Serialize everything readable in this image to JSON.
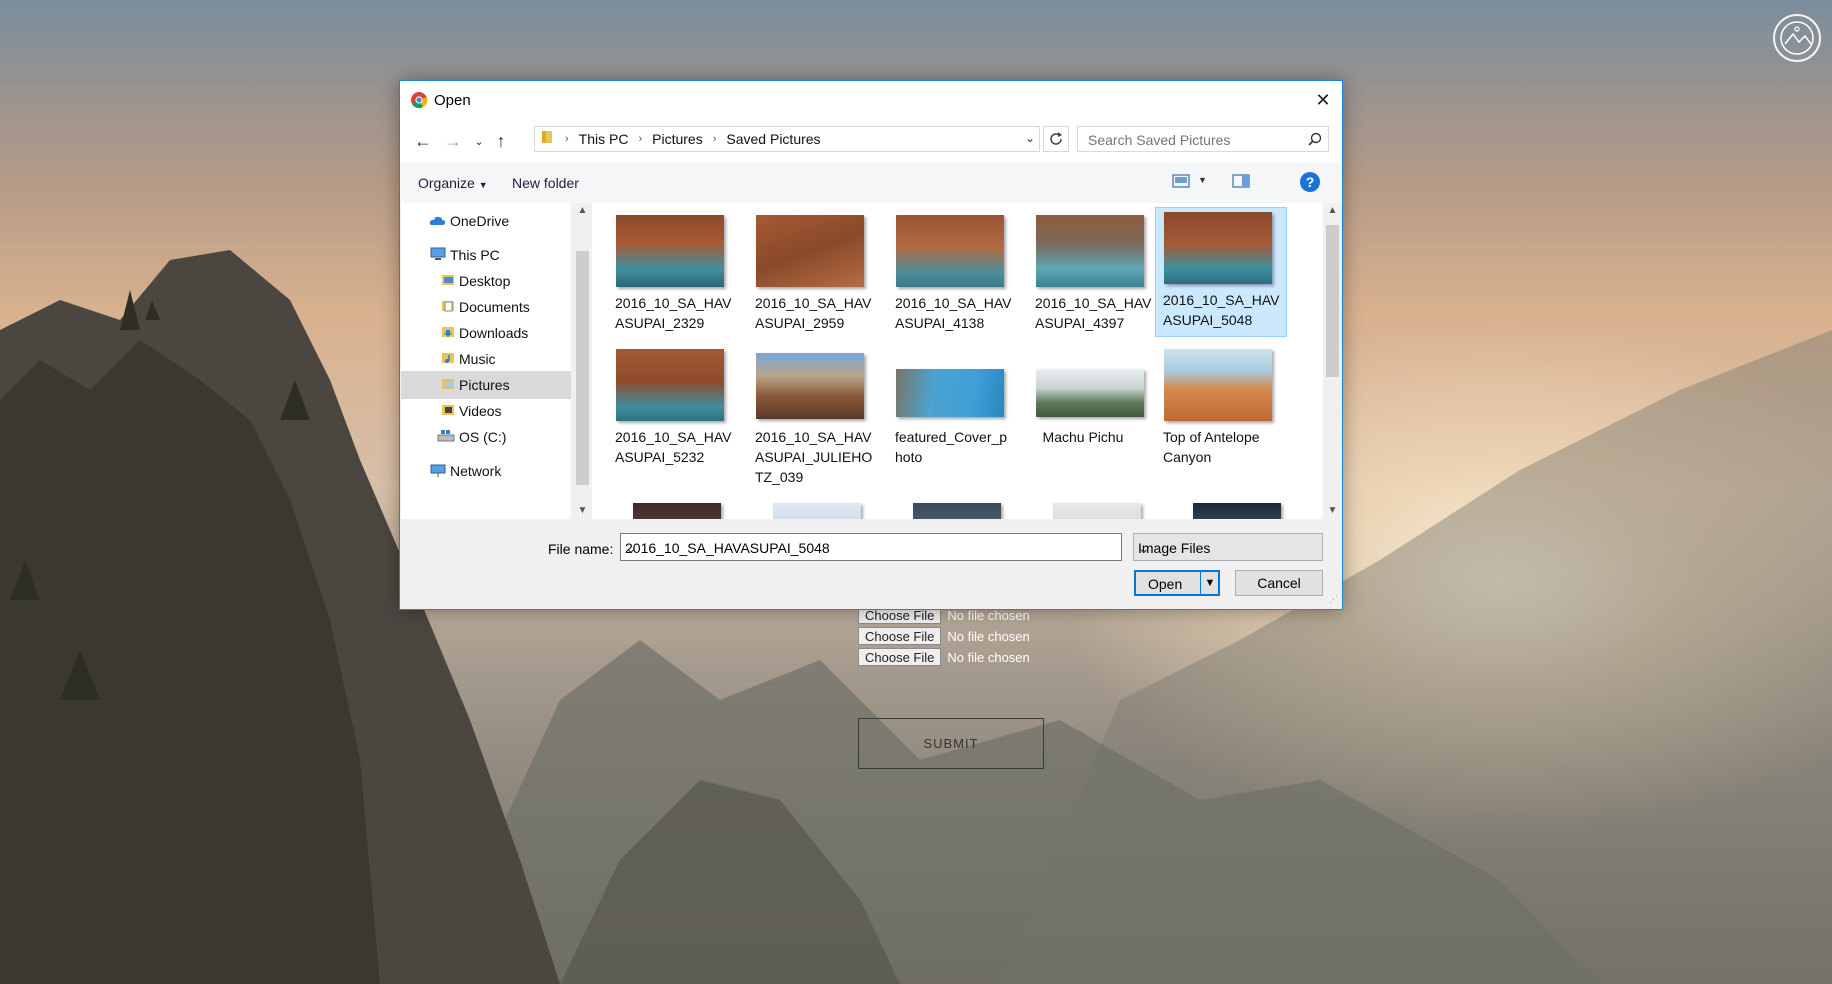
{
  "page": {
    "no_file_label": "No file chosen",
    "choose_label": "Choose File",
    "submit_label": "SUBMIT"
  },
  "dialog": {
    "title": "Open",
    "breadcrumb": [
      "This PC",
      "Pictures",
      "Saved Pictures"
    ],
    "search_placeholder": "Search Saved Pictures",
    "toolbar": {
      "organize": "Organize",
      "new_folder": "New folder"
    },
    "nav": [
      {
        "label": "OneDrive",
        "icon": "onedrive-icon"
      },
      {
        "label": "This PC",
        "icon": "computer-icon"
      },
      {
        "label": "Desktop",
        "icon": "folder-icon"
      },
      {
        "label": "Documents",
        "icon": "documents-icon"
      },
      {
        "label": "Downloads",
        "icon": "downloads-icon"
      },
      {
        "label": "Music",
        "icon": "music-icon"
      },
      {
        "label": "Pictures",
        "icon": "pictures-icon",
        "selected": true
      },
      {
        "label": "Videos",
        "icon": "videos-icon"
      },
      {
        "label": "OS (C:)",
        "icon": "drive-icon"
      },
      {
        "label": "Network",
        "icon": "network-icon"
      }
    ],
    "files": [
      {
        "name": "2016_10_SA_HAVASUPAI_2329",
        "lines": [
          "2016_10_SA_HAV",
          "ASUPAI_2329"
        ]
      },
      {
        "name": "2016_10_SA_HAVASUPAI_2959",
        "lines": [
          "2016_10_SA_HAV",
          "ASUPAI_2959"
        ]
      },
      {
        "name": "2016_10_SA_HAVASUPAI_4138",
        "lines": [
          "2016_10_SA_HAV",
          "ASUPAI_4138"
        ]
      },
      {
        "name": "2016_10_SA_HAVASUPAI_4397",
        "lines": [
          "2016_10_SA_HAV",
          "ASUPAI_4397"
        ]
      },
      {
        "name": "2016_10_SA_HAVASUPAI_5048",
        "lines": [
          "2016_10_SA_HAV",
          "ASUPAI_5048"
        ],
        "selected": true
      },
      {
        "name": "2016_10_SA_HAVASUPAI_5232",
        "lines": [
          "2016_10_SA_HAV",
          "ASUPAI_5232"
        ]
      },
      {
        "name": "2016_10_SA_HAVASUPAI_JULIEHOTZ_039",
        "lines": [
          "2016_10_SA_HAV",
          "ASUPAI_JULIEHO",
          "TZ_039"
        ]
      },
      {
        "name": "featured_Cover_photo",
        "lines": [
          "featured_Cover_p",
          "hoto"
        ]
      },
      {
        "name": "Machu Pichu",
        "lines": [
          "Machu Pichu"
        ]
      },
      {
        "name": "Top of Antelope Canyon",
        "lines": [
          "Top of Antelope",
          "Canyon"
        ]
      }
    ],
    "filename_label": "File name:",
    "filename_value": "2016_10_SA_HAVASUPAI_5048",
    "filetype": "Image Files",
    "open_label": "Open",
    "cancel_label": "Cancel"
  }
}
